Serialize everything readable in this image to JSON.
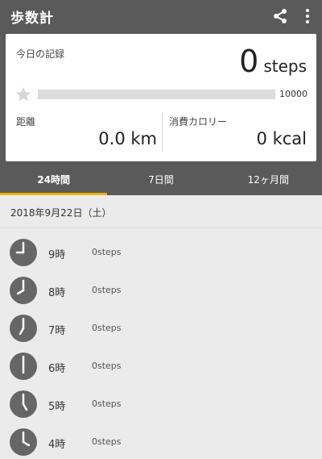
{
  "app": {
    "title": "歩数計",
    "icons": {
      "share": "share-icon",
      "more": "more-vert-icon"
    }
  },
  "summary": {
    "label": "今日の記録",
    "steps_value": "0",
    "steps_unit": "steps",
    "progress_fraction": 0,
    "goal": "10000",
    "distance_label": "距離",
    "distance_value": "0.0 km",
    "calorie_label": "消費カロリー",
    "calorie_value": "0 kcal"
  },
  "tabs": [
    {
      "label": "24時間",
      "active": true
    },
    {
      "label": "7日間",
      "active": false
    },
    {
      "label": "12ヶ月間",
      "active": false
    }
  ],
  "date": "2018年9月22日（土）",
  "rows": [
    {
      "hour": 9,
      "label": "9時",
      "steps": "0steps"
    },
    {
      "hour": 8,
      "label": "8時",
      "steps": "0steps"
    },
    {
      "hour": 7,
      "label": "7時",
      "steps": "0steps"
    },
    {
      "hour": 6,
      "label": "6時",
      "steps": "0steps"
    },
    {
      "hour": 5,
      "label": "5時",
      "steps": "0steps"
    },
    {
      "hour": 4,
      "label": "4時",
      "steps": "0steps"
    }
  ],
  "colors": {
    "header_bg": "#5a5a5a",
    "accent": "#f0b400",
    "clock_face": "#666666",
    "list_bg": "#ebebeb"
  }
}
